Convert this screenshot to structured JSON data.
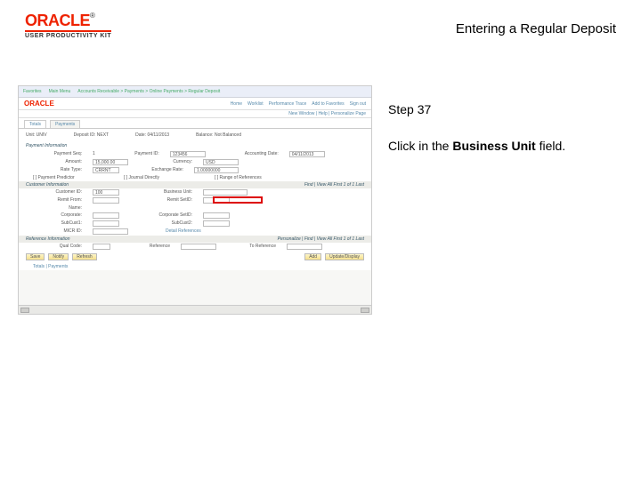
{
  "header": {
    "logo": "ORACLE",
    "tm": "®",
    "kit": "USER PRODUCTIVITY KIT",
    "title": "Entering a Regular Deposit"
  },
  "instruction": {
    "step": "Step 37",
    "prefix": "Click in the ",
    "bold": "Business Unit",
    "suffix": " field."
  },
  "shot": {
    "topbar": {
      "a": "Favorites",
      "b": "Main Menu",
      "c": "Accounts Receivable > Payments > Online Payments > Regular Deposit"
    },
    "rlinks": {
      "a": "Home",
      "b": "Worklist",
      "c": "Performance Trace",
      "d": "Add to Favorites",
      "e": "Sign out"
    },
    "sublinks": "New Window | Help | Personalize Page",
    "tabs": {
      "a": "Totals",
      "b": "Payments"
    },
    "hdr": {
      "unit_l": "Unit:",
      "unit_v": "UNIV",
      "dep_l": "Deposit ID:",
      "dep_v": "NEXT",
      "date_l": "Date:",
      "date_v": "04/11/2013",
      "bal_l": "Balance:",
      "bal_v": "Not Balanced"
    },
    "pi": {
      "title": "Payment Information",
      "seq_l": "Payment Seq:",
      "seq_v": "1",
      "pid_l": "Payment ID:",
      "pid_v": "123456",
      "acct_l": "Accounting Date:",
      "acct_v": "04/11/2013",
      "amt_l": "Amount:",
      "amt_v": "15,000.00",
      "cur_l": "Currency:",
      "cur_v": "USD",
      "rate_l": "Rate Type:",
      "rate_v": "CRRNT",
      "ex_l": "Exchange Rate:",
      "ex_v": "1.00000000",
      "pp": "[ ] Payment Predictor",
      "je": "[ ] Journal Directly",
      "rr": "[ ] Range of References"
    },
    "ci": {
      "bar": "Customer Information",
      "nav": "Find | View All   First 1 of 1 Last",
      "cust_l": "Customer ID:",
      "cust_v": "100",
      "bu_l": "Business Unit:",
      "remit_l": "Remit From:",
      "remit_seq_l": "Remit SetID:",
      "name_l": "Name:",
      "corp_l": "Corporate:",
      "corpset_l": "Corporate SetID:",
      "sub_l": "SubCust1:",
      "sub2_l": "SubCust2:",
      "mcr_l": "MICR ID:",
      "link": "Detail References"
    },
    "ri": {
      "bar": "Reference Information",
      "nav": "Personalize | Find | View All   First 1 of 1 Last",
      "qual_l": "Qual Code:",
      "ref_l": "Reference",
      "to_l": "To Reference"
    },
    "btns": {
      "save": "Save",
      "notify": "Notify",
      "refresh": "Refresh",
      "add": "Add",
      "upd": "Update/Display"
    },
    "crumb": "Totals | Payments"
  }
}
